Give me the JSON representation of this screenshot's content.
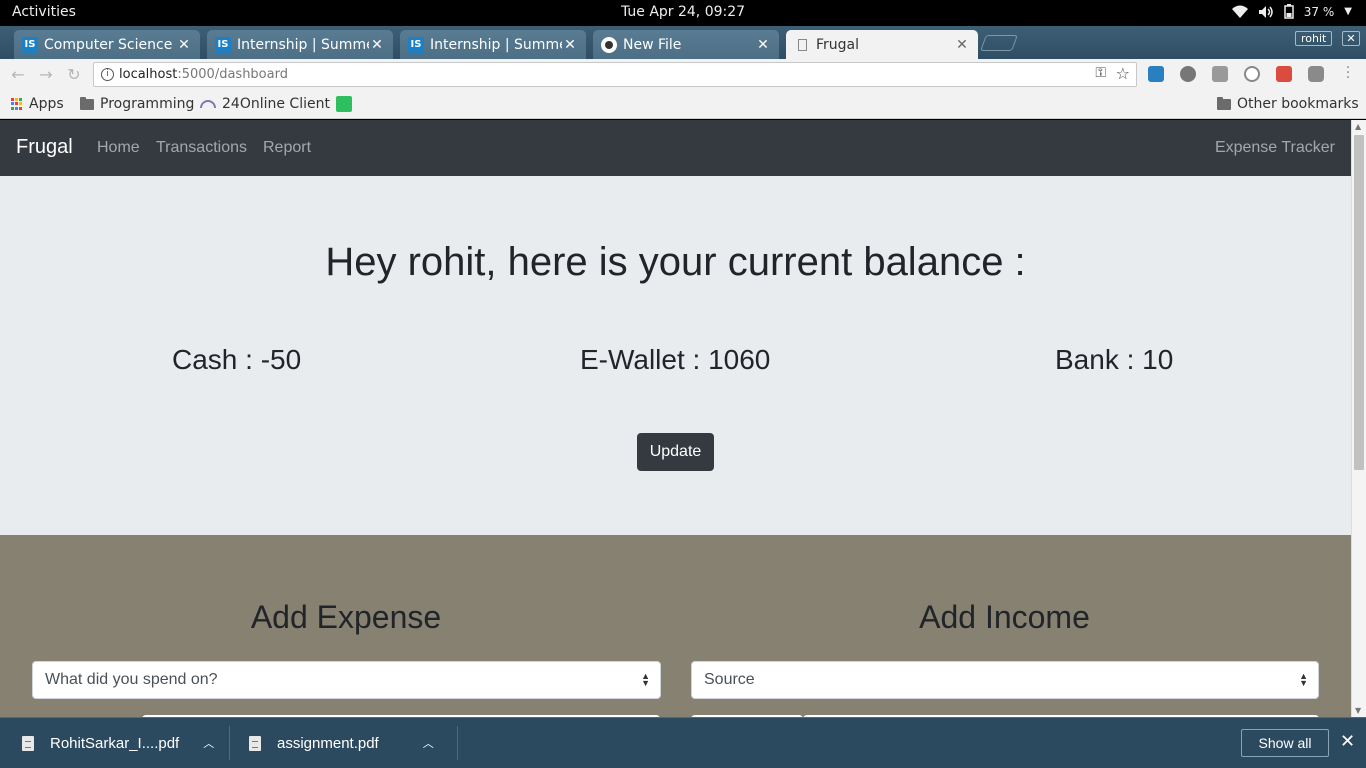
{
  "os": {
    "activities": "Activities",
    "clock": "Tue Apr 24, 09:27",
    "battery": "37 %"
  },
  "browser": {
    "tabs": [
      {
        "title": "Computer Science In",
        "favicon": "IS"
      },
      {
        "title": "Internship | Summer",
        "favicon": "IS"
      },
      {
        "title": "Internship | Summer",
        "favicon": "IS"
      },
      {
        "title": "New File",
        "favicon": "github-icon"
      },
      {
        "title": "Frugal",
        "favicon": "page-icon"
      }
    ],
    "profile": "rohit",
    "url_host": "localhost",
    "url_path": ":5000/dashboard",
    "bookmarks": [
      "Apps",
      "Programming",
      "24Online Client"
    ],
    "other_bookmarks": "Other bookmarks"
  },
  "page": {
    "brand": "Frugal",
    "nav_links": [
      "Home",
      "Transactions",
      "Report"
    ],
    "nav_right": "Expense Tracker",
    "greeting": "Hey rohit, here is your current balance :",
    "balances": {
      "cash": "Cash : -50",
      "ewallet": "E-Wallet : 1060",
      "bank": "Bank : 10"
    },
    "update_label": "Update",
    "add_expense": {
      "title": "Add Expense",
      "select_value": "What did you spend on?"
    },
    "add_income": {
      "title": "Add Income",
      "select_value": "Source"
    }
  },
  "downloads": {
    "items": [
      "RohitSarkar_I....pdf",
      "assignment.pdf"
    ],
    "show_all": "Show all"
  },
  "colors": {
    "navbar": "#343a40",
    "jumbotron": "#e9ecef",
    "forms_bg": "#868171",
    "chrome_frame": "#2f4e63"
  }
}
